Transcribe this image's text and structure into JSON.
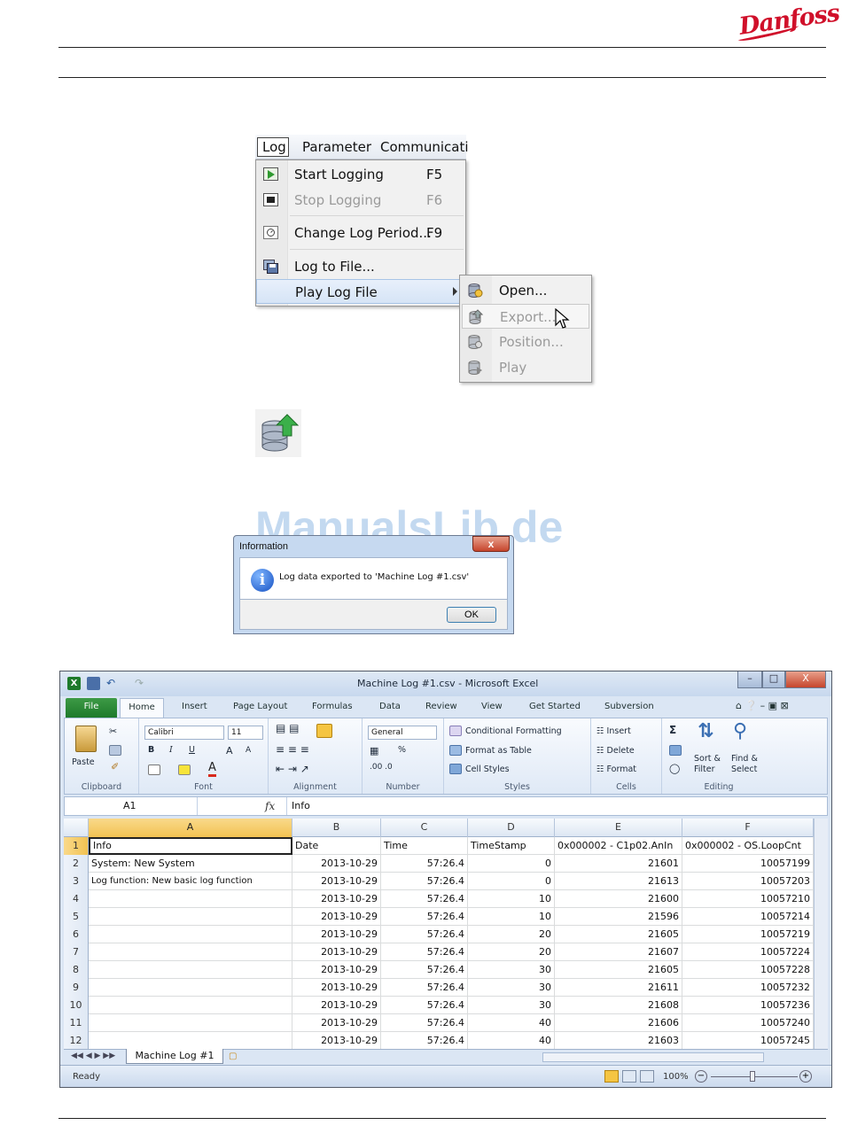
{
  "brand": {
    "logo_text": "Danfoss",
    "color": "#d0102a"
  },
  "log_menu": {
    "menubar": [
      "Log",
      "Parameter",
      "Communicati"
    ],
    "items": [
      {
        "icon": "play-icon",
        "label": "Start Logging",
        "shortcut": "F5",
        "enabled": true
      },
      {
        "icon": "stop-icon",
        "label": "Stop Logging",
        "shortcut": "F6",
        "enabled": false
      },
      {
        "icon": "clock-icon",
        "label": "Change Log Period...",
        "shortcut": "F9",
        "enabled": true
      },
      {
        "icon": "save-icon",
        "label": "Log to File...",
        "shortcut": "",
        "enabled": true
      },
      {
        "icon": "",
        "label": "Play Log File",
        "shortcut": "",
        "enabled": true,
        "has_submenu": true
      }
    ],
    "submenu": [
      {
        "icon": "database-open-icon",
        "label": "Open...",
        "enabled": true
      },
      {
        "icon": "database-export-icon",
        "label": "Export...",
        "enabled": false
      },
      {
        "icon": "database-position-icon",
        "label": "Position...",
        "enabled": false
      },
      {
        "icon": "database-play-icon",
        "label": "Play",
        "enabled": false
      }
    ]
  },
  "watermark": "ManualsLib.de",
  "dialog": {
    "title": "Information",
    "close": "x",
    "message": "Log data exported to 'Machine Log #1.csv'",
    "ok": "OK"
  },
  "excel": {
    "title": "Machine Log #1.csv - Microsoft Excel",
    "window_buttons": [
      "–",
      "□",
      "X"
    ],
    "tabs": [
      "File",
      "Home",
      "Insert",
      "Page Layout",
      "Formulas",
      "Data",
      "Review",
      "View",
      "Get Started",
      "Subversion"
    ],
    "ribbon": {
      "clipboard": {
        "label": "Clipboard",
        "paste": "Paste"
      },
      "font": {
        "label": "Font",
        "name": "Calibri",
        "size": "11",
        "bold": "B",
        "italic": "I",
        "underline": "U",
        "grow": "A",
        "shrink": "A"
      },
      "alignment": {
        "label": "Alignment"
      },
      "number": {
        "label": "Number",
        "format": "General",
        "percent": "%"
      },
      "styles": {
        "label": "Styles",
        "conditional": "Conditional Formatting",
        "table": "Format as Table",
        "cell": "Cell Styles"
      },
      "cells": {
        "label": "Cells",
        "insert": "Insert",
        "delete": "Delete",
        "format": "Format"
      },
      "editing": {
        "label": "Editing",
        "sort": "Sort &",
        "filter": "Filter",
        "find": "Find &",
        "select": "Select"
      }
    },
    "name_box": "A1",
    "fx": "fx",
    "formula": "Info",
    "columns": [
      "A",
      "B",
      "C",
      "D",
      "E",
      "F"
    ],
    "rows": [
      {
        "n": "1",
        "A": "Info",
        "B": "Date",
        "C": "Time",
        "D": "TimeStamp",
        "E": "0x000002 - C1p02.AnIn",
        "F": "0x000002 - OS.LoopCnt"
      },
      {
        "n": "2",
        "A": "System: New System",
        "B": "2013-10-29",
        "C": "57:26.4",
        "D": "0",
        "E": "21601",
        "F": "10057199"
      },
      {
        "n": "3",
        "A": "Log function: New basic log function",
        "B": "2013-10-29",
        "C": "57:26.4",
        "D": "0",
        "E": "21613",
        "F": "10057203"
      },
      {
        "n": "4",
        "A": "",
        "B": "2013-10-29",
        "C": "57:26.4",
        "D": "10",
        "E": "21600",
        "F": "10057210"
      },
      {
        "n": "5",
        "A": "",
        "B": "2013-10-29",
        "C": "57:26.4",
        "D": "10",
        "E": "21596",
        "F": "10057214"
      },
      {
        "n": "6",
        "A": "",
        "B": "2013-10-29",
        "C": "57:26.4",
        "D": "20",
        "E": "21605",
        "F": "10057219"
      },
      {
        "n": "7",
        "A": "",
        "B": "2013-10-29",
        "C": "57:26.4",
        "D": "20",
        "E": "21607",
        "F": "10057224"
      },
      {
        "n": "8",
        "A": "",
        "B": "2013-10-29",
        "C": "57:26.4",
        "D": "30",
        "E": "21605",
        "F": "10057228"
      },
      {
        "n": "9",
        "A": "",
        "B": "2013-10-29",
        "C": "57:26.4",
        "D": "30",
        "E": "21611",
        "F": "10057232"
      },
      {
        "n": "10",
        "A": "",
        "B": "2013-10-29",
        "C": "57:26.4",
        "D": "30",
        "E": "21608",
        "F": "10057236"
      },
      {
        "n": "11",
        "A": "",
        "B": "2013-10-29",
        "C": "57:26.4",
        "D": "40",
        "E": "21606",
        "F": "10057240"
      },
      {
        "n": "12",
        "A": "",
        "B": "2013-10-29",
        "C": "57:26.4",
        "D": "40",
        "E": "21603",
        "F": "10057245"
      }
    ],
    "sheet_tab": "Machine Log #1",
    "status": "Ready",
    "zoom": "100%"
  }
}
